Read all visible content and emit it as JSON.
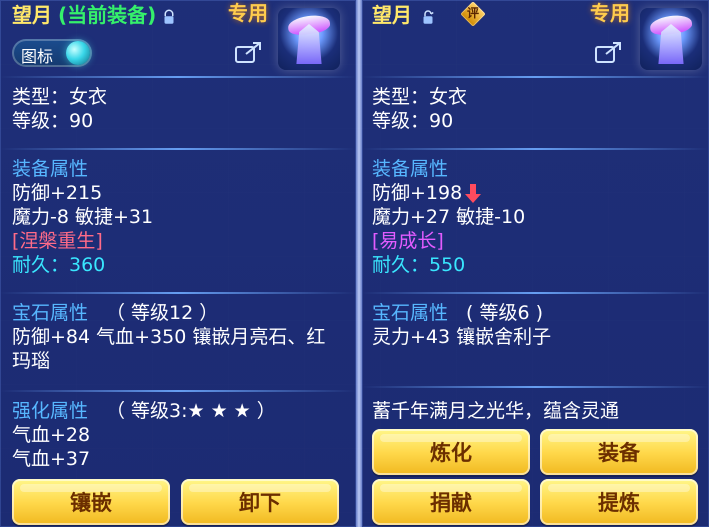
{
  "left": {
    "title_name": "望月",
    "title_equipped": "(当前装备)",
    "specialty": "专用",
    "toggle_label": "图标",
    "type_line": "类型：女衣",
    "level_line": "等级：90",
    "equip_attr_title": "装备属性",
    "defense": "防御+215",
    "magic_agility": "魔力-8 敏捷+31",
    "special_effect": "[涅槃重生]",
    "durability": "耐久：360",
    "gem_title": "宝石属性",
    "gem_level": "（ 等级12 ）",
    "gem_line1": "防御+84 气血+350 镶嵌月亮石、红",
    "gem_line2": "玛瑙",
    "enhance_title": "强化属性",
    "enhance_level": "（ 等级3:★ ★ ★ ）",
    "enhance_line1": "气血+28",
    "enhance_line2": "气血+37",
    "btn_inlay": "镶嵌",
    "btn_unequip": "卸下"
  },
  "right": {
    "title_name": "望月",
    "badge_text": "评",
    "specialty": "专用",
    "type_line": "类型：女衣",
    "level_line": "等级：90",
    "equip_attr_title": "装备属性",
    "defense": "防御+198",
    "magic_agility": "魔力+27 敏捷-10",
    "special_effect": "[易成长]",
    "durability": "耐久：550",
    "gem_title": "宝石属性",
    "gem_level": "( 等级6 )",
    "gem_line1": "灵力+43 镶嵌舍利子",
    "desc": "蓄千年满月之光华，蕴含灵通",
    "btn_refine": "炼化",
    "btn_equip": "装备",
    "btn_donate": "捐献",
    "btn_extract": "提炼"
  },
  "colors": {
    "accent_yellow": "#ffe86a",
    "accent_green": "#35f06b",
    "accent_blue": "#57b7ff",
    "accent_cyan": "#39e7ff",
    "accent_pink": "#ff6b88",
    "accent_magenta": "#e25cff"
  }
}
